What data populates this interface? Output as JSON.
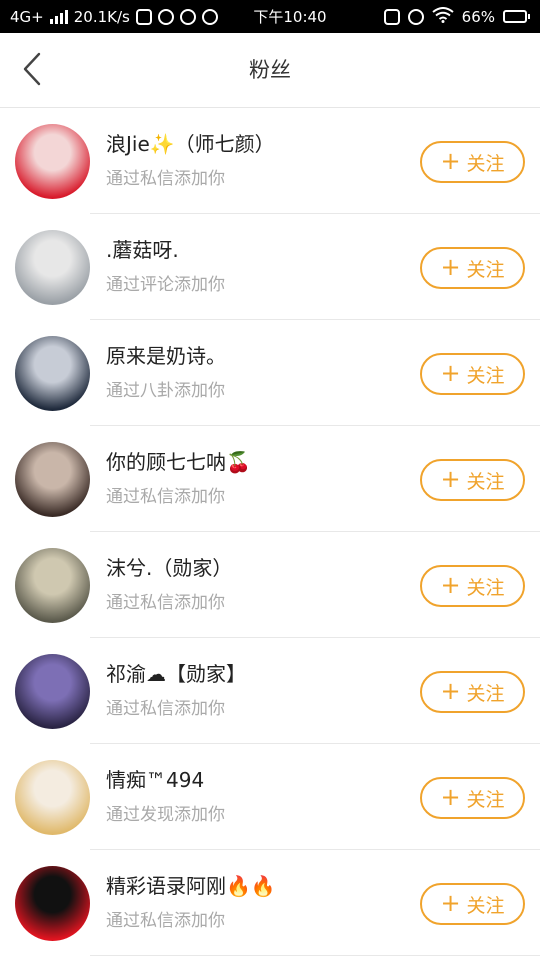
{
  "status_bar": {
    "network": "4G+",
    "speed": "20.1K/s",
    "time": "下午10:40",
    "battery": "66%",
    "battery_level": 0.66
  },
  "header": {
    "title": "粉丝",
    "back_icon": "chevron-left-icon"
  },
  "follow_label": "关注",
  "followers": [
    {
      "name": "浪Jie✨（师七颜）",
      "source": "通过私信添加你",
      "avatar_colors": [
        "#d81b2c",
        "#f3d6d6"
      ]
    },
    {
      "name": ".蘑菇呀.",
      "source": "通过评论添加你",
      "avatar_colors": [
        "#9aa0a6",
        "#e7e7e7"
      ]
    },
    {
      "name": "原来是奶诗。",
      "source": "通过八卦添加你",
      "avatar_colors": [
        "#1f2a3c",
        "#c7ccd6"
      ]
    },
    {
      "name": "你的顾七七呐🍒",
      "source": "通过私信添加你",
      "avatar_colors": [
        "#3a2b26",
        "#c9b6a9"
      ]
    },
    {
      "name": "沫兮.（勋家）",
      "source": "通过私信添加你",
      "avatar_colors": [
        "#5b5a4c",
        "#cfc8b0"
      ]
    },
    {
      "name": "祁渝☁【勋家】",
      "source": "通过私信添加你",
      "avatar_colors": [
        "#2a2444",
        "#7d6fb5"
      ]
    },
    {
      "name": "情痴™494",
      "source": "通过发现添加你",
      "avatar_colors": [
        "#e0b96b",
        "#f4ece0"
      ]
    },
    {
      "name": "精彩语录阿刚🔥🔥",
      "source": "通过私信添加你",
      "avatar_colors": [
        "#e01420",
        "#111111"
      ]
    }
  ]
}
